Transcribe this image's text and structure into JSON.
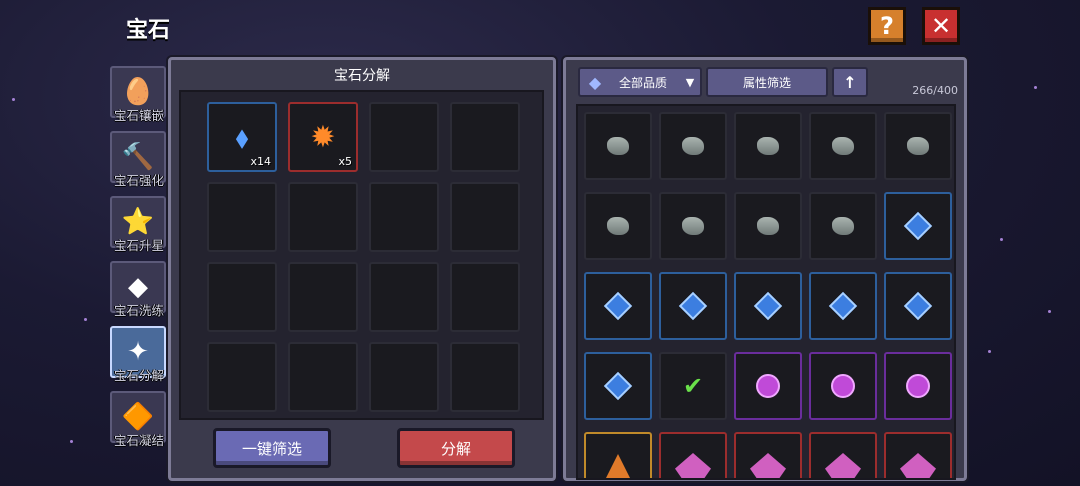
{
  "page_title": "宝石",
  "top_buttons": {
    "help": "?",
    "close": "✕"
  },
  "side_tabs": [
    {
      "label": "宝石镶嵌",
      "icon": "gem-inlay-icon",
      "glyph": "🥚",
      "active": false
    },
    {
      "label": "宝石强化",
      "icon": "gem-enhance-icon",
      "glyph": "🔨",
      "active": false
    },
    {
      "label": "宝石升星",
      "icon": "gem-star-icon",
      "glyph": "⭐",
      "active": false
    },
    {
      "label": "宝石洗练",
      "icon": "gem-refine-icon",
      "glyph": "◆",
      "active": false
    },
    {
      "label": "宝石分解",
      "icon": "gem-decompose-icon",
      "glyph": "✦",
      "active": true
    },
    {
      "label": "宝石凝结",
      "icon": "gem-condense-icon",
      "glyph": "🔶",
      "active": false
    }
  ],
  "decompose_panel": {
    "title": "宝石分解",
    "slots": [
      {
        "item": "blue-crystal-icon",
        "glyph": "⬧",
        "count": "x14",
        "rarity": "blue"
      },
      {
        "item": "flame-gem-icon",
        "glyph": "✹",
        "count": "x5",
        "rarity": "red"
      }
    ],
    "buttons": {
      "filter": "一键筛选",
      "decompose": "分解"
    }
  },
  "inventory": {
    "quality_filter": "全部品质",
    "attr_filter": "属性筛选",
    "sort": "↑",
    "capacity": "266/400",
    "items": [
      "rock",
      "rock",
      "rock",
      "rock",
      "rock",
      "rock",
      "rock",
      "rock",
      "rock",
      "blue",
      "blue",
      "blue",
      "blue",
      "blue",
      "blue",
      "blue",
      "check",
      "purple",
      "purple",
      "purple",
      "gold",
      "crystal",
      "crystal",
      "crystal",
      "crystal"
    ]
  }
}
